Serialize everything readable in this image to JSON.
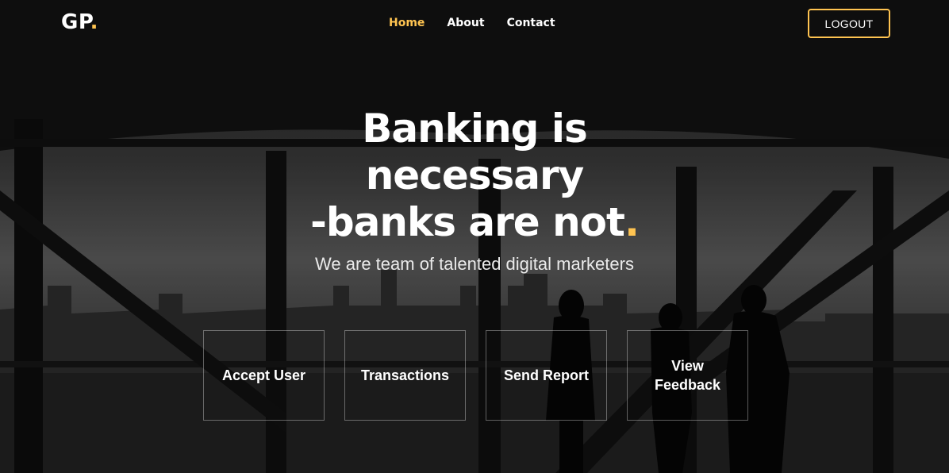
{
  "brand": {
    "name": "GP",
    "dot": "."
  },
  "nav": {
    "items": [
      {
        "label": "Home",
        "active": true
      },
      {
        "label": "About",
        "active": false
      },
      {
        "label": "Contact",
        "active": false
      }
    ]
  },
  "header": {
    "logout_label": "LOGOUT"
  },
  "hero": {
    "line1": "Banking is",
    "line2": "necessary",
    "line3": "-banks are not",
    "line3_accent": ".",
    "tagline": "We are team of talented digital marketers"
  },
  "actions": [
    {
      "label": "Accept User"
    },
    {
      "label": "Transactions"
    },
    {
      "label": "Send Report"
    },
    {
      "label": "View Feedback",
      "line1": "View",
      "line2": "Feedback"
    }
  ],
  "colors": {
    "accent": "#ffc451",
    "background": "#141414"
  }
}
